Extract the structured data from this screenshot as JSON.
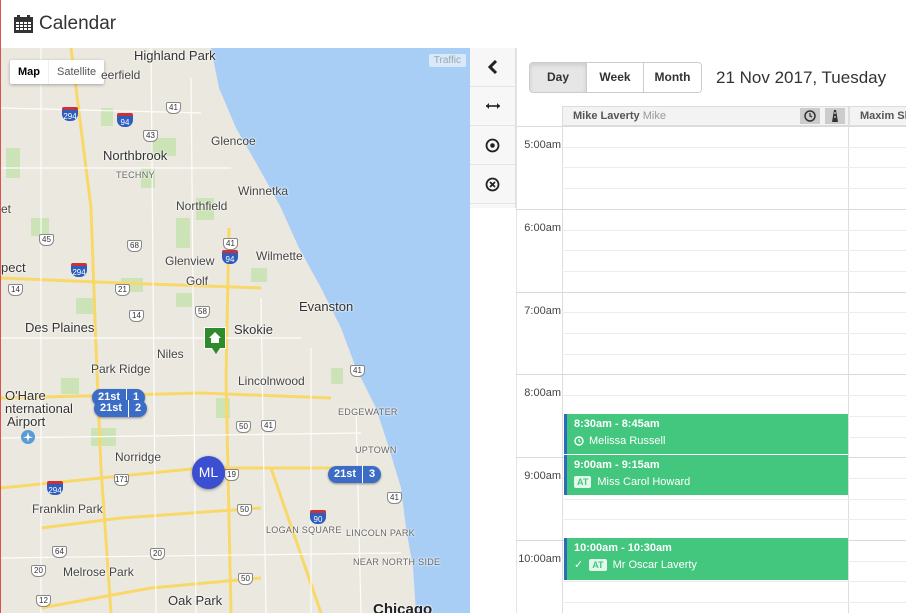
{
  "header": {
    "title": "Calendar",
    "icon": "calendar-icon"
  },
  "map": {
    "type_buttons": {
      "map": "Map",
      "satellite": "Satellite"
    },
    "traffic": "Traffic",
    "places": {
      "highland_park": "Highland Park",
      "deerfield": "eerfield",
      "glencoe": "Glencoe",
      "northbrook": "Northbrook",
      "techny": "TECHNY",
      "winnetka": "Winnetka",
      "northfield": "Northfield",
      "glenview": "Glenview",
      "wilmette": "Wilmette",
      "golf": "Golf",
      "evanston": "Evanston",
      "skokie": "Skokie",
      "des_plaines": "Des Plaines",
      "niles": "Niles",
      "park_ridge": "Park Ridge",
      "lincolnwood": "Lincolnwood",
      "ohare": "O'Hare",
      "international": "nternational",
      "airport": "Airport",
      "edgewater": "EDGEWATER",
      "uptown": "UPTOWN",
      "norridge": "Norridge",
      "franklin_park": "Franklin Park",
      "logan_square": "LOGAN SQUARE",
      "lincoln_park": "LINCOLN PARK",
      "near_north_side": "NEAR NORTH SIDE",
      "melrose_park": "Melrose Park",
      "oak_park": "Oak Park",
      "chicago": "Chicago",
      "spect": "pect",
      "et": "et"
    },
    "routes": [
      "41",
      "294",
      "94",
      "43",
      "68",
      "45",
      "294",
      "41",
      "14",
      "21",
      "58",
      "94",
      "14",
      "50",
      "19",
      "41",
      "171",
      "294",
      "50",
      "90",
      "41",
      "64",
      "20",
      "20",
      "50",
      "41",
      "12"
    ],
    "clusters": [
      {
        "label": "21st",
        "count": "1"
      },
      {
        "label": "21st",
        "count": "2"
      },
      {
        "label": "21st",
        "count": "3"
      }
    ],
    "ml_marker": "ML"
  },
  "toolbar": {
    "buttons": [
      "collapse",
      "expand",
      "locate",
      "clear"
    ]
  },
  "calendar": {
    "views": {
      "day": "Day",
      "week": "Week",
      "month": "Month"
    },
    "active_view": "Day",
    "date": "21 Nov 2017, Tuesday",
    "columns": [
      {
        "name": "Mike Laverty",
        "sub": "Mike"
      },
      {
        "name": "Maxim Sh",
        "sub": ""
      }
    ],
    "hours": [
      "5:00am",
      "6:00am",
      "7:00am",
      "8:00am",
      "9:00am",
      "10:00am"
    ],
    "events": [
      {
        "time": "8:30am - 8:45am",
        "name": "Melissa Russell",
        "icon": "clock-icon",
        "badge": ""
      },
      {
        "time": "9:00am - 9:15am",
        "name": "Miss Carol Howard",
        "icon": "",
        "badge": "AT"
      },
      {
        "time": "10:00am - 10:30am",
        "name": "Mr Oscar Laverty",
        "icon": "check-icon",
        "badge": "AT"
      }
    ],
    "colors": {
      "event": "#43c67d",
      "event_border": "#2d6bb8"
    }
  }
}
